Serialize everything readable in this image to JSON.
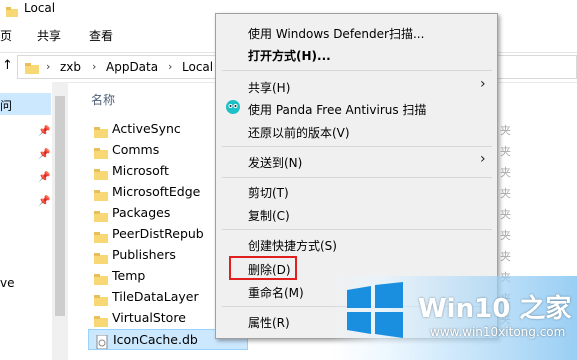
{
  "window": {
    "title": "Local"
  },
  "ribbon": {
    "tabs": [
      "页",
      "共享",
      "查看"
    ]
  },
  "address": {
    "crumbs": [
      "zxb",
      "AppData",
      "Local"
    ]
  },
  "nav": {
    "selected_label": "问",
    "bottom_label": "ve"
  },
  "list": {
    "column_name": "名称",
    "items": [
      "ActiveSync",
      "Comms",
      "Microsoft",
      "MicrosoftEdge",
      "Packages",
      "PeerDistRepub",
      "Publishers",
      "Temp",
      "TileDataLayer",
      "VirtualStore",
      "IconCache.db"
    ],
    "selected_index": 10
  },
  "context_menu": {
    "items": [
      {
        "label": "使用 Windows Defender扫描...",
        "bold": false
      },
      {
        "label": "打开方式(H)...",
        "bold": true
      },
      {
        "label": "共享(H)",
        "submenu": true
      },
      {
        "label": "使用 Panda Free Antivirus 扫描",
        "icon": "panda-icon"
      },
      {
        "label": "还原以前的版本(V)"
      },
      {
        "label": "发送到(N)",
        "submenu": true
      },
      {
        "label": "剪切(T)"
      },
      {
        "label": "复制(C)"
      },
      {
        "label": "创建快捷方式(S)"
      },
      {
        "label": "删除(D)",
        "highlighted": true,
        "highlight_color": "#e02020"
      },
      {
        "label": "重命名(M)"
      },
      {
        "label": "属性(R)"
      }
    ]
  },
  "side_chars": [
    "夹",
    "夹",
    "夹",
    "夹",
    "夹",
    "夹",
    "夹",
    "夹",
    "夹",
    "夹"
  ],
  "watermark": {
    "title": "Win10 之家",
    "url": "www.win10xitong.com"
  },
  "colors": {
    "selection": "#cce8ff",
    "folder": "#f8d775",
    "highlight": "#e02020",
    "brand": "#1a8fe0"
  }
}
